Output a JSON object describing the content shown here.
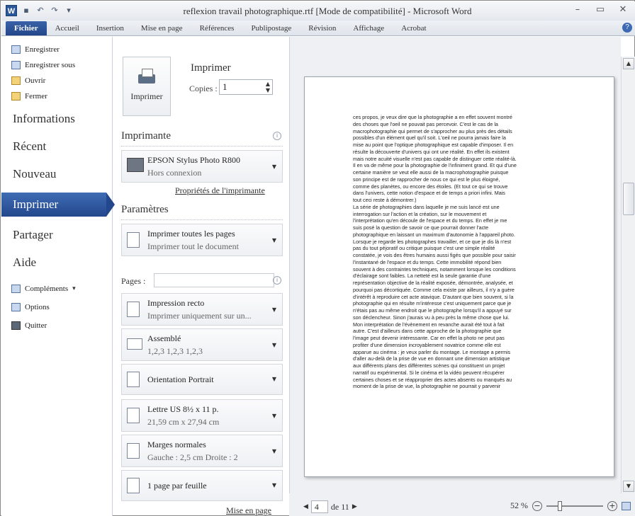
{
  "window": {
    "title": "reflexion travail photographique.rtf [Mode de compatibilité] - Microsoft Word",
    "app_icon": "W",
    "controls": [
      "minimize-icon",
      "restore-icon",
      "close-icon"
    ]
  },
  "ribbon": {
    "tabs": [
      "Fichier",
      "Accueil",
      "Insertion",
      "Mise en page",
      "Références",
      "Publipostage",
      "Révision",
      "Affichage",
      "Acrobat"
    ],
    "active_tab": "Fichier"
  },
  "nav": {
    "small_top": [
      "Enregistrer",
      "Enregistrer sous",
      "Ouvrir",
      "Fermer"
    ],
    "big": [
      "Informations",
      "Récent",
      "Nouveau",
      "Imprimer",
      "Partager",
      "Aide"
    ],
    "selected": "Imprimer",
    "small_bottom": [
      "Compléments",
      "Options",
      "Quitter"
    ]
  },
  "print": {
    "title": "Imprimer",
    "button": "Imprimer",
    "copies_label": "Copies :",
    "copies_value": "1",
    "printer_header": "Imprimante",
    "printer_name": "EPSON Stylus Photo R800",
    "printer_status": "Hors connexion",
    "printer_props": "Propriétés de l'imprimante",
    "settings_header": "Paramètres",
    "settings": [
      {
        "t1": "Imprimer toutes les pages",
        "t2": "Imprimer tout le document"
      },
      {
        "t1": "Impression recto",
        "t2": "Imprimer uniquement sur un..."
      },
      {
        "t1": "Assemblé",
        "t2": "1,2,3   1,2,3   1,2,3"
      },
      {
        "t1": "Orientation Portrait",
        "t2": ""
      },
      {
        "t1": "Lettre US 8½ x 11 p.",
        "t2": "21,59 cm x 27,94 cm"
      },
      {
        "t1": "Marges normales",
        "t2": "Gauche : 2,5 cm   Droite : 2"
      },
      {
        "t1": "1 page par feuille",
        "t2": ""
      }
    ],
    "pages_label": "Pages :",
    "page_setup": "Mise en page"
  },
  "preview": {
    "lines": [
      "ces propos, je veux dire que la photographie a en effet souvent montré",
      "des choses que l'oeil ne pouvait pas percevoir. C'est le cas de la",
      "macrophotographie qui permet de s'approcher au plus près des détails",
      "possibles d'un élément quel qu'il soit. L'oeil ne pourra jamais faire la",
      "mise au point que l'optique photographique est capable d'imposer. Il en",
      "résulte la découverte d'univers qui ont une réalité. En effet ils existent",
      "mais notre acuité visuelle n'est pas capable de distinguer cette réalité-là.",
      "Il en va de même pour la photographie de l'infiniment grand. Et qui d'une",
      "certaine manière se veut elle aussi de la macrophotographie puisque",
      "son principe est de rapprocher de nous ce qui est le plus éloigné,",
      "comme des planètes, ou encore des étoiles. (Et tout ce qui se trouve",
      "dans l'univers, cette notion d'espace et de temps a priori infini.   Mais",
      "tout ceci reste à démontrer.)",
      "La série de photographies dans laquelle je me suis lancé est une",
      "interrogation sur l'action et la création, sur le mouvement et",
      "l'interprétation qu'en découle de l'espace et du temps. En effet je me",
      "suis posé la question de savoir ce que pourrait donner l'acte",
      "photographique en laissant un maximum d'autonomie à l'appareil photo.",
      "Lorsque je regarde les photographes travailler, et ce que je dis là n'est",
      "pas du tout péjoratif ou critique puisque c'est une simple réalité",
      "constatée, je vois des êtres humains aussi figés que possible pour saisir",
      "l'instantané de l'espace et du temps. Cette immobilité répond bien",
      "souvent à des contraintes techniques, notamment lorsque les conditions",
      "d'éclairage sont faibles. La netteté est la seule garantie d'une",
      "représentation objective de la réalité exposée, démontrée, analysée, et",
      "pourquoi pas décortiquée. Comme cela existe par ailleurs, il n'y a guère",
      "d'intérêt à reproduire cet acte atavique. D'autant que bien souvent, si la",
      "photographie qui en résulte m'intéresse c'est uniquement parce que je",
      "n'étais pas au même endroit que le photographe lorsqu'il a appuyé sur",
      "son déclencheur. Sinon j'aurais vu à peu près la même chose que lui.",
      "Mon interprétation de l'évènement en revanche aurait été tout à fait",
      "autre. C'est d'ailleurs dans cette approche de la photographie que",
      "l'image peut devenir intéressante. Car en effet la photo ne peut pas",
      "profiter d'une dimension incroyablement novatrice comme elle est",
      "apparue au cinéma : je veux parler du montage. Le montage a permis",
      "d'aller au-delà de la prise de vue en donnant une dimension artistique",
      "aux différents plans des différentes scènes qui constituent un projet",
      "narratif ou expérimental. Si le cinéma et la vidéo peuvent récupérer",
      "certaines choses et se réapproprier des actes absents ou manqués au",
      "moment de la prise de vue, la photographie ne pourrait y parvenir"
    ],
    "page_current": "4",
    "page_of": "de 11",
    "zoom_label": "52 %",
    "zoom_fraction": 0.52
  }
}
